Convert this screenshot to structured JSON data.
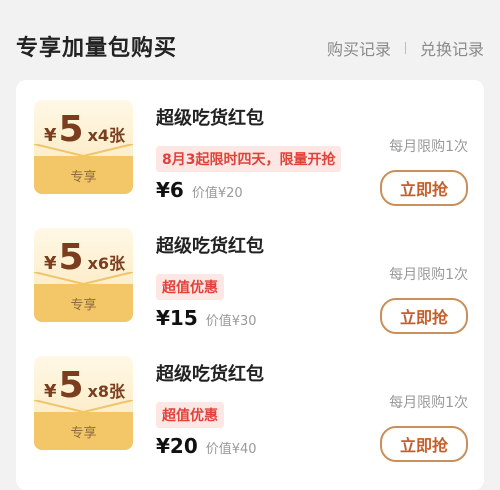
{
  "header": {
    "title": "专享加量包购买",
    "links": [
      "购买记录",
      "兑换记录"
    ]
  },
  "items": [
    {
      "env_yen": "¥",
      "env_value": "5",
      "env_count": "x4张",
      "env_tag": "专享",
      "name": "超级吃货红包",
      "badge": "8月3起限时四天，限量开抢",
      "price": "¥6",
      "orig_price": "价值¥20",
      "limit": "每月限购1次",
      "buy": "立即抢"
    },
    {
      "env_yen": "¥",
      "env_value": "5",
      "env_count": "x6张",
      "env_tag": "专享",
      "name": "超级吃货红包",
      "badge": "超值优惠",
      "price": "¥15",
      "orig_price": "价值¥30",
      "limit": "每月限购1次",
      "buy": "立即抢"
    },
    {
      "env_yen": "¥",
      "env_value": "5",
      "env_count": "x8张",
      "env_tag": "专享",
      "name": "超级吃货红包",
      "badge": "超值优惠",
      "price": "¥20",
      "orig_price": "价值¥40",
      "limit": "每月限购1次",
      "buy": "立即抢"
    }
  ]
}
